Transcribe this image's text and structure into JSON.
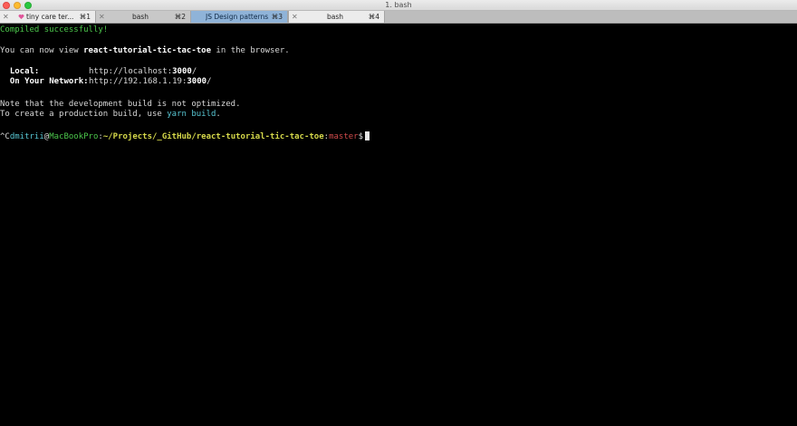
{
  "window": {
    "title": "1. bash"
  },
  "tabs": [
    {
      "label": "tiny care ter...",
      "shortcut": "⌘1"
    },
    {
      "label": "bash",
      "shortcut": "⌘2"
    },
    {
      "label": "JS Design patterns...",
      "shortcut": "⌘3"
    },
    {
      "label": "bash",
      "shortcut": "⌘4"
    }
  ],
  "terminal": {
    "compiled": "Compiled successfully!",
    "view_prefix": "You can now view ",
    "app_name": "react-tutorial-tic-tac-toe",
    "view_suffix": " in the browser.",
    "local_label": "Local:",
    "local_url_prefix": "http://localhost:",
    "local_port": "3000",
    "local_url_suffix": "/",
    "network_label": "On Your Network:",
    "network_url_prefix": "http://192.168.1.19:",
    "network_port": "3000",
    "network_url_suffix": "/",
    "note_line": "Note that the development build is not optimized.",
    "build_prefix": "To create a production build, use ",
    "build_cmd": "yarn build",
    "build_suffix": ".",
    "prompt_ctrl": "^C",
    "prompt_user": "dmitrii",
    "prompt_at": "@",
    "prompt_host": "MacBookPro",
    "prompt_colon": ":",
    "prompt_path": "~/Projects/_GitHub/react-tutorial-tic-tac-toe",
    "prompt_colon2": ":",
    "prompt_branch": "master",
    "prompt_dollar": "$"
  },
  "colors": {
    "success": "#4cc94c",
    "accent": "#58c7d4",
    "path": "#d5d84a",
    "branch": "#d24b4b",
    "highlight_tab": "#8fb3d8"
  }
}
